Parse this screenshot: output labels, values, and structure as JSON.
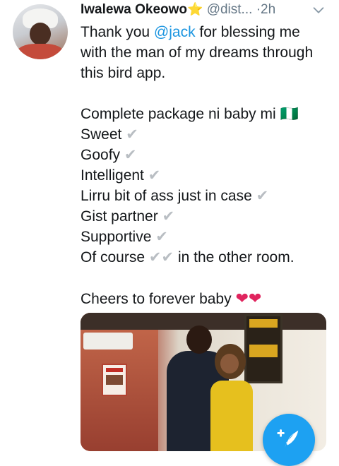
{
  "tweet": {
    "author_name": "Iwalewa Okeowo",
    "author_badge": "⭐",
    "handle": "@dist...",
    "separator": "·",
    "time": "2h",
    "lines": {
      "l1_pre": "Thank you ",
      "l1_mention": "@jack",
      "l1_post": " for blessing me",
      "l2": "with the man of my dreams through",
      "l3": "this bird app.",
      "l5": "Complete package ni baby mi 🇳🇬",
      "l6": "Sweet",
      "l7": "Goofy",
      "l8": "Intelligent",
      "l9": "Lirru bit of ass just in case",
      "l10": "Gist partner",
      "l11": "Supportive",
      "l12_pre": "Of course",
      "l12_post": " in the other room.",
      "l14": "Cheers to forever baby"
    },
    "check": "✔",
    "heart": "❤"
  },
  "icons": {
    "more": "chevron-down-icon",
    "compose": "compose-tweet-icon"
  },
  "colors": {
    "link": "#1b95e0",
    "muted": "#657786",
    "fab": "#1da1f2",
    "heart": "#e0245e"
  }
}
